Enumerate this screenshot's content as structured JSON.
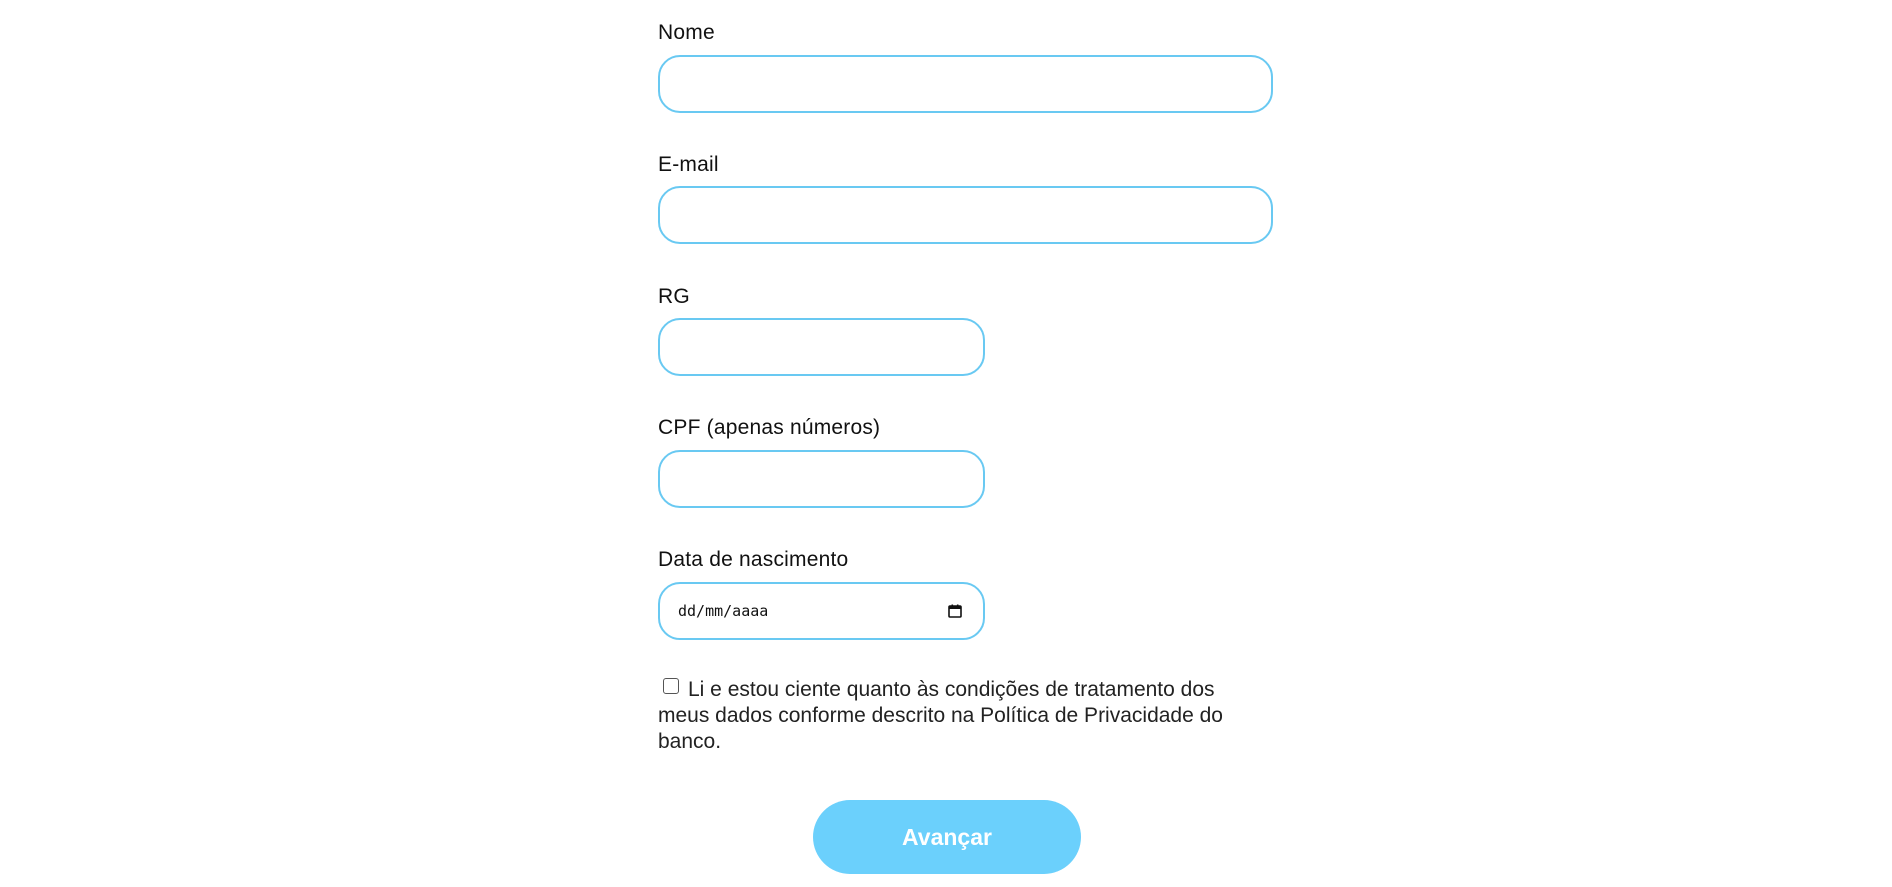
{
  "form": {
    "fields": [
      {
        "label": "Nome",
        "value": "",
        "placeholder": ""
      },
      {
        "label": "E-mail",
        "value": "",
        "placeholder": ""
      },
      {
        "label": "RG",
        "value": "",
        "placeholder": ""
      },
      {
        "label": "CPF (apenas números)",
        "value": "",
        "placeholder": ""
      },
      {
        "label": "Data de nascimento",
        "value": "",
        "placeholder": "dd/mm/aaaa"
      }
    ],
    "consent": {
      "checked": false,
      "text": "Li e estou ciente quanto às condições de tratamento dos meus dados conforme descrito na Política de Privacidade do banco."
    },
    "submit_label": "Avançar"
  },
  "colors": {
    "input_border": "#69c9f2",
    "button_background": "#6bd0fc",
    "button_text": "#ffffff"
  },
  "icons": {
    "date_picker": "calendar-icon"
  }
}
